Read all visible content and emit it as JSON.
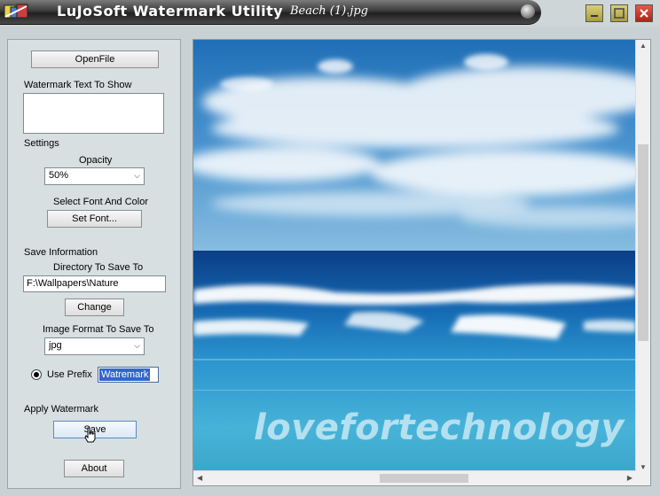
{
  "window": {
    "app_title": "LuJoSoft Watermark Utility",
    "document_title": "Beach (1).jpg"
  },
  "panel": {
    "open_file_label": "OpenFile",
    "watermark_text_label": "Watermark Text To Show",
    "watermark_text_value": "",
    "settings_label": "Settings",
    "opacity_label": "Opacity",
    "opacity_value": "50%",
    "font_color_label": "Select Font And Color",
    "set_font_label": "Set Font...",
    "save_info_label": "Save Information",
    "directory_label": "Directory To Save To",
    "directory_value": "F:\\Wallpapers\\Nature",
    "change_label": "Change",
    "format_label": "Image Format To Save To",
    "format_value": "jpg",
    "use_prefix_label": "Use Prefix",
    "prefix_value": "Watremark",
    "apply_label": "Apply Watermark",
    "save_label": "Save",
    "about_label": "About"
  },
  "preview": {
    "watermark_overlay": "lovefortechnology"
  },
  "colors": {
    "title_bar": "#2c2c2c",
    "panel_bg": "#d7dfe0",
    "selection": "#3366cc",
    "close_button": "#c0392b"
  }
}
